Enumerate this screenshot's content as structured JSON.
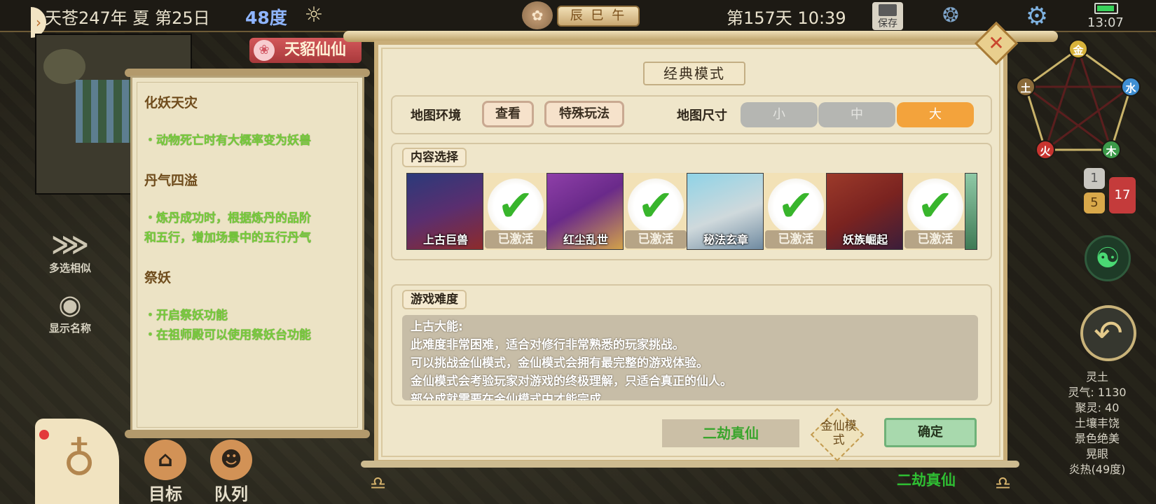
{
  "topbar": {
    "date": "天苍247年 夏 第25日",
    "temperature": "48度",
    "hours": "辰 巳 午",
    "day_time": "第157天 10:39",
    "save_label": "保存",
    "clock": "13:07"
  },
  "left": {
    "pet_tag": "天貂仙仙",
    "multi_select": "多选相似",
    "show_names": "显示名称",
    "nav_target": "目标",
    "nav_team": "队列"
  },
  "scroll": {
    "sections": [
      {
        "title": "化妖天灾",
        "lines": [
          "・动物死亡时有大概率变为妖兽"
        ]
      },
      {
        "title": "丹气四溢",
        "lines": [
          "・炼丹成功时，根据炼丹的品阶",
          "和五行，增加场景中的五行丹气"
        ]
      },
      {
        "title": "祭妖",
        "lines": [
          "・开启祭妖功能",
          "・在祖师殿可以使用祭妖台功能"
        ]
      }
    ]
  },
  "dialog": {
    "title": "经典模式",
    "map_env_label": "地图环境",
    "view_button": "查看",
    "special_button": "特殊玩法",
    "map_size_label": "地图尺寸",
    "sizes": [
      {
        "label": "小",
        "active": false
      },
      {
        "label": "中",
        "active": false
      },
      {
        "label": "大",
        "active": true
      }
    ],
    "content_label": "内容选择",
    "cards": [
      {
        "name": "上古巨兽",
        "status": "已激活"
      },
      {
        "name": "红尘乱世",
        "status": "已激活"
      },
      {
        "name": "秘法玄章",
        "status": "已激活"
      },
      {
        "name": "妖族崛起",
        "status": "已激活"
      }
    ],
    "difficulty_label": "游戏难度",
    "difficulty_text": [
      "上古大能:",
      "此难度非常困难，适合对修行非常熟悉的玩家挑战。",
      "可以挑战金仙模式，金仙模式会拥有最完整的游戏体验。",
      "金仙模式会考验玩家对游戏的终极理解，只适合真正的仙人。",
      "部分成就需要在金仙模式中才能完成"
    ],
    "difficulty_button": "二劫真仙",
    "jinxian_mode": "金仙模式",
    "confirm": "确定"
  },
  "bottom_difficulty": "二劫真仙",
  "right": {
    "wuxing": [
      "金",
      "水",
      "木",
      "火",
      "土"
    ],
    "chat_counts": [
      "1",
      "5",
      "17"
    ],
    "info": [
      "灵土",
      "灵气: 1130",
      "聚灵: 40",
      "土壤丰饶",
      "景色绝美",
      "晃眼",
      "炎热(49度)"
    ]
  },
  "colors": {
    "active_size": "#f3a33c",
    "green_text": "#77cb3b",
    "confirm_bg": "#a8d9ad"
  }
}
